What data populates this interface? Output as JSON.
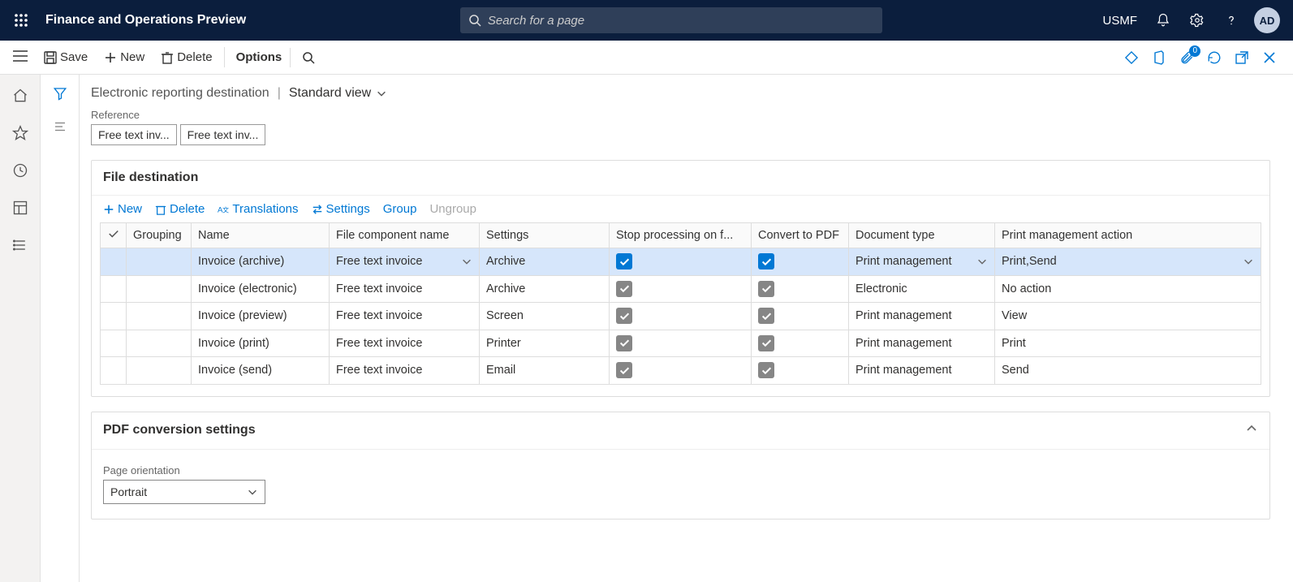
{
  "header": {
    "app_title": "Finance and Operations Preview",
    "search_placeholder": "Search for a page",
    "company": "USMF",
    "avatar": "AD",
    "attach_badge": "0"
  },
  "action_bar": {
    "save": "Save",
    "new": "New",
    "delete": "Delete",
    "options": "Options"
  },
  "breadcrumb": {
    "title": "Electronic reporting destination",
    "view": "Standard view"
  },
  "reference": {
    "label": "Reference",
    "chips": [
      "Free text inv...",
      "Free text inv..."
    ]
  },
  "file_destination": {
    "title": "File destination",
    "toolbar": {
      "new": "New",
      "delete": "Delete",
      "translations": "Translations",
      "settings": "Settings",
      "group": "Group",
      "ungroup": "Ungroup"
    },
    "columns": {
      "grouping": "Grouping",
      "name": "Name",
      "file_component": "File component name",
      "settings": "Settings",
      "stop": "Stop processing on f...",
      "convert": "Convert to PDF",
      "doc_type": "Document type",
      "pm_action": "Print management action"
    },
    "rows": [
      {
        "name": "Invoice (archive)",
        "file_component": "Free text invoice",
        "settings": "Archive",
        "stop": true,
        "convert": true,
        "doc_type": "Print management",
        "pm_action": "Print,Send",
        "selected": true
      },
      {
        "name": "Invoice (electronic)",
        "file_component": "Free text invoice",
        "settings": "Archive",
        "stop": true,
        "convert": true,
        "doc_type": "Electronic",
        "pm_action": "No action",
        "selected": false
      },
      {
        "name": "Invoice (preview)",
        "file_component": "Free text invoice",
        "settings": "Screen",
        "stop": true,
        "convert": true,
        "doc_type": "Print management",
        "pm_action": "View",
        "selected": false
      },
      {
        "name": "Invoice (print)",
        "file_component": "Free text invoice",
        "settings": "Printer",
        "stop": true,
        "convert": true,
        "doc_type": "Print management",
        "pm_action": "Print",
        "selected": false
      },
      {
        "name": "Invoice (send)",
        "file_component": "Free text invoice",
        "settings": "Email",
        "stop": true,
        "convert": true,
        "doc_type": "Print management",
        "pm_action": "Send",
        "selected": false
      }
    ]
  },
  "pdf_settings": {
    "title": "PDF conversion settings",
    "page_orientation_label": "Page orientation",
    "page_orientation_value": "Portrait"
  }
}
